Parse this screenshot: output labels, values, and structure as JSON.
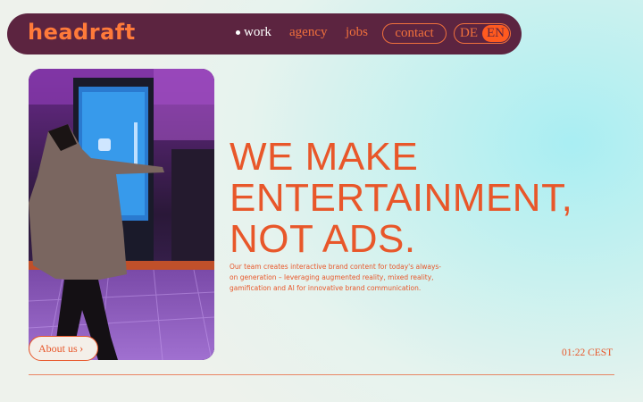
{
  "brand": {
    "logo": "headraft"
  },
  "nav": {
    "items": [
      {
        "label": "work",
        "active": true
      },
      {
        "label": "agency",
        "active": false
      },
      {
        "label": "jobs",
        "active": false
      }
    ],
    "contact_label": "contact",
    "languages": {
      "inactive": "DE",
      "active": "EN"
    }
  },
  "hero": {
    "headline": [
      "WE MAKE",
      "ENTERTAINMENT,",
      "NOT ADS."
    ],
    "description": "Our team creates interactive brand content for today's always-on generation – leveraging augmented reality, mixed reality, gamification and AI for innovative brand communication.",
    "about_label": "About us",
    "about_icon": "chevron-right-icon"
  },
  "clock": "01:22 CEST",
  "colors": {
    "accent": "#e8572a",
    "nav_bg": "#5c2440",
    "lang_active_bg": "#ff5a1f"
  }
}
